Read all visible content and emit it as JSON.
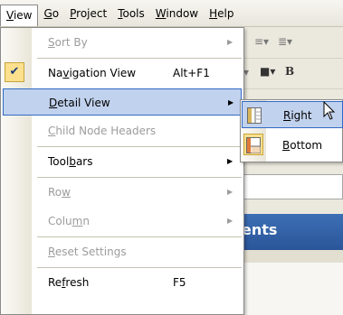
{
  "menubar": {
    "items": [
      {
        "label": "View",
        "u": "V",
        "rest": "iew"
      },
      {
        "label": "Go",
        "u": "G",
        "rest": "o"
      },
      {
        "label": "Project",
        "u": "P",
        "rest": "roject"
      },
      {
        "label": "Tools",
        "u": "T",
        "rest": "ools"
      },
      {
        "label": "Window",
        "u": "W",
        "rest": "indow"
      },
      {
        "label": "Help",
        "u": "H",
        "rest": "elp"
      }
    ]
  },
  "view_menu": {
    "items": [
      {
        "pre": "",
        "u": "S",
        "post": "ort By",
        "accel": "",
        "submenu": true,
        "enabled": false
      },
      {
        "pre": "Na",
        "u": "v",
        "post": "igation View",
        "accel": "Alt+F1",
        "submenu": false,
        "enabled": true,
        "checked": true
      },
      {
        "pre": "",
        "u": "D",
        "post": "etail View",
        "accel": "",
        "submenu": true,
        "enabled": true,
        "highlighted": true
      },
      {
        "pre": "",
        "u": "C",
        "post": "hild Node Headers",
        "accel": "",
        "submenu": false,
        "enabled": false
      },
      {
        "pre": "Tool",
        "u": "b",
        "post": "ars",
        "accel": "",
        "submenu": true,
        "enabled": true
      },
      {
        "pre": "Ro",
        "u": "w",
        "post": "",
        "accel": "",
        "submenu": true,
        "enabled": false
      },
      {
        "pre": "Colu",
        "u": "m",
        "post": "n",
        "accel": "",
        "submenu": true,
        "enabled": false
      },
      {
        "pre": "",
        "u": "R",
        "post": "eset Settings",
        "accel": "",
        "submenu": false,
        "enabled": false
      },
      {
        "pre": "Re",
        "u": "f",
        "post": "resh",
        "accel": "F5",
        "submenu": false,
        "enabled": true
      }
    ]
  },
  "detail_submenu": {
    "items": [
      {
        "u": "R",
        "post": "ight",
        "icon": "pane-right-icon",
        "highlighted": true
      },
      {
        "u": "B",
        "post": "ottom",
        "icon": "pane-bottom-icon",
        "highlighted": false
      }
    ]
  },
  "background": {
    "panel_title": "ents"
  },
  "colors": {
    "highlight": "#c1d2ee",
    "highlight_border": "#316ac5",
    "disabled_text": "#9c9c9c",
    "title_bar": "#2a5599"
  }
}
